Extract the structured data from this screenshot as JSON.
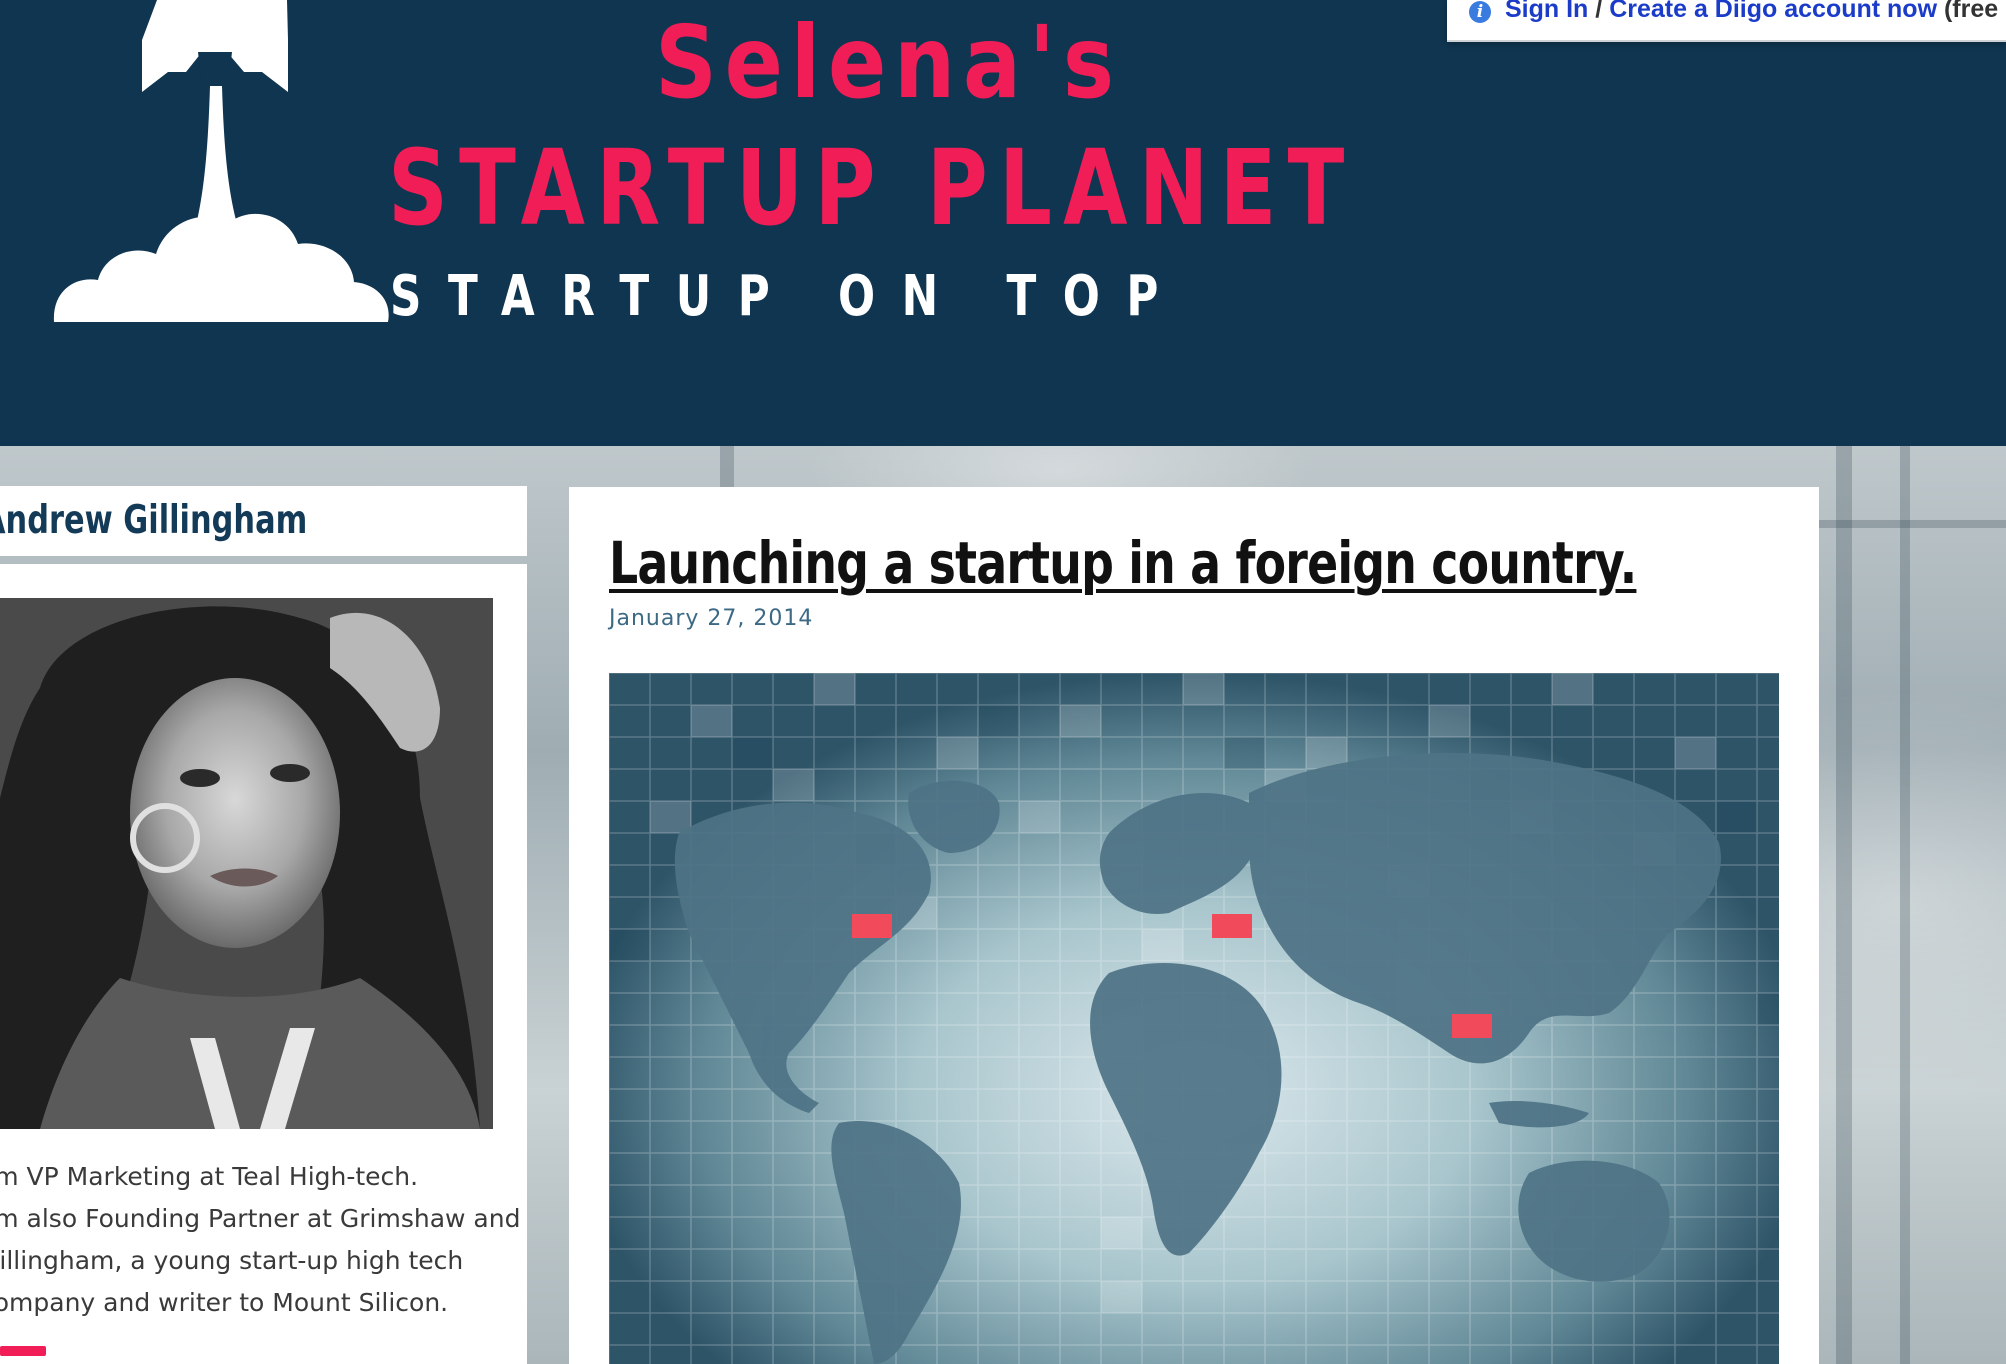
{
  "diigo": {
    "sign_in": "Sign In",
    "separator": "/",
    "create_account": "Create a Diigo account now",
    "suffix": "(free"
  },
  "header": {
    "brand_line1": "Selena's",
    "brand_line2": "STARTUP PLANET",
    "tagline": "STARTUP ON TOP"
  },
  "sidebar": {
    "author_name": "Andrew Gillingham",
    "bio_lines": [
      "I'm VP Marketing at Teal High-tech.",
      "I'm  also Founding Partner at Grimshaw and",
      "Gillingham, a young start-up high tech",
      "company and writer to Mount Silicon."
    ]
  },
  "post": {
    "title": "Launching a startup in a foreign country.",
    "date": "January 27, 2014"
  },
  "colors": {
    "header_bg": "#0f3550",
    "brand_pink": "#f01d57",
    "link_blue": "#1a3cc8",
    "date_blue": "#3c6a85",
    "map_marker": "#f04a5b"
  },
  "icons": {
    "rocket": "rocket-logo-icon",
    "info": "info-icon"
  }
}
